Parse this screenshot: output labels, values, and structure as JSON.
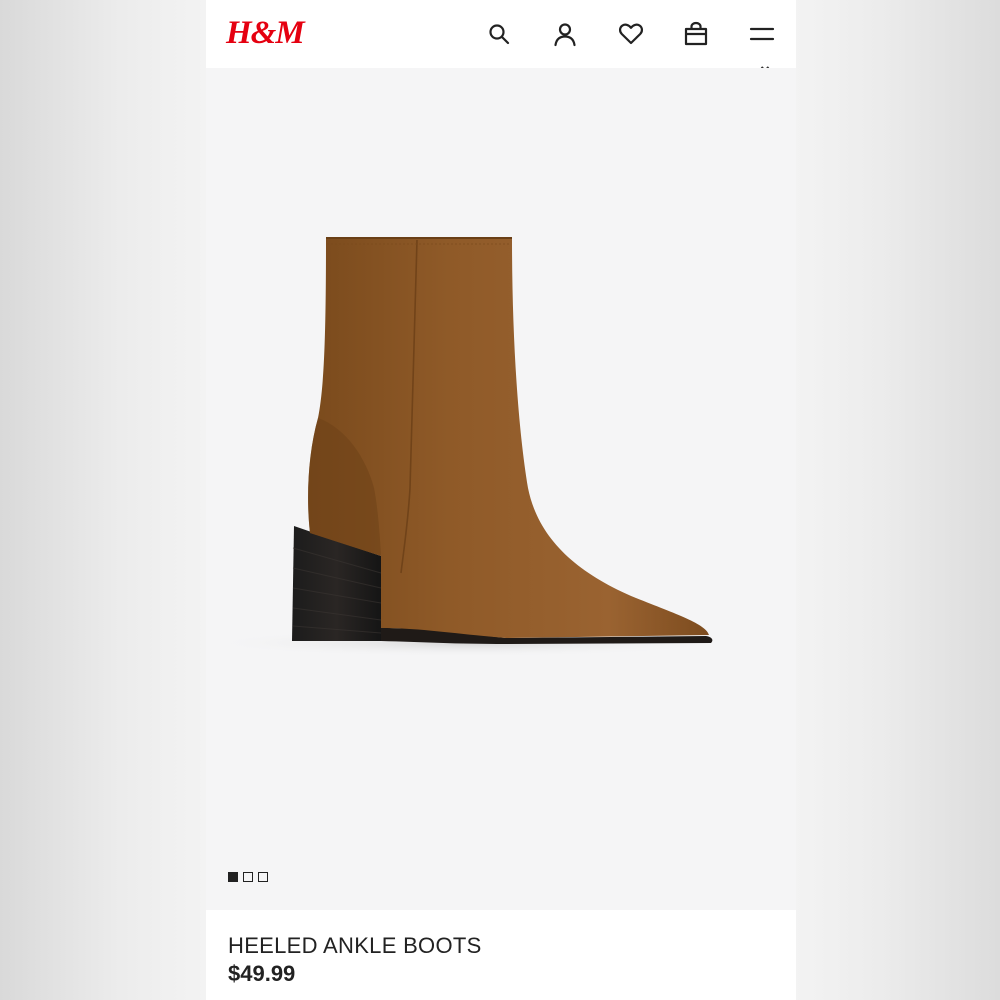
{
  "header": {
    "logo_text": "H&M",
    "brand_color": "#e50010",
    "icons": [
      "search-icon",
      "account-icon",
      "favorites-heart-icon",
      "shopping-bag-icon",
      "menu-icon"
    ]
  },
  "gallery": {
    "image": "brown-heeled-ankle-boot",
    "current_slide": 1,
    "total_slides": 3
  },
  "product": {
    "title": "HEELED ANKLE BOOTS",
    "price": "$49.99"
  }
}
